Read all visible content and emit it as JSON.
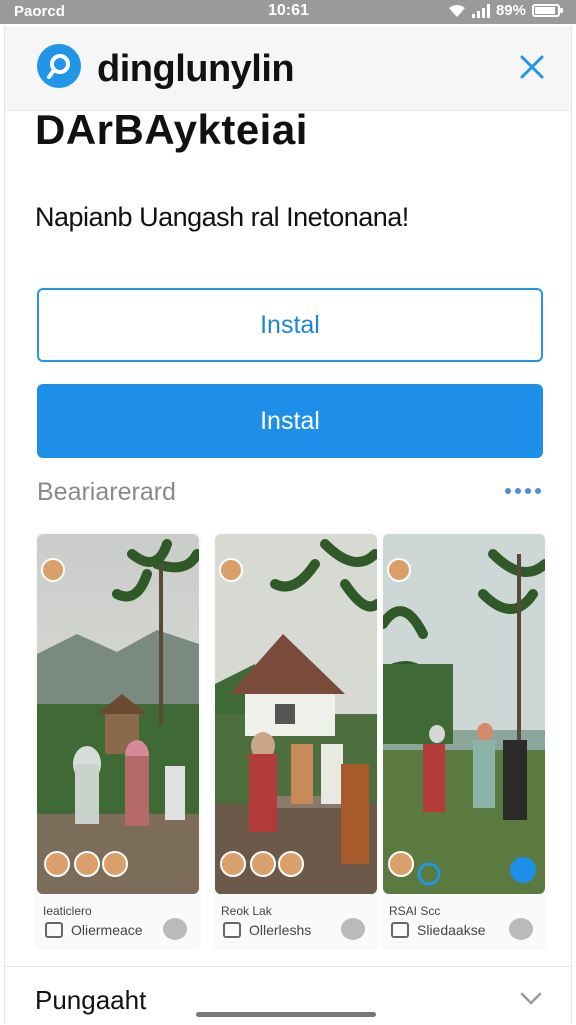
{
  "status_bar": {
    "carrier": "Paorcd",
    "time": "10:61",
    "battery": "89%",
    "battery_level": 0.89
  },
  "app": {
    "name": "dinglunylin",
    "title": "DArBAykteiai",
    "subtitle": "Napianb Uangash ral Inetonana!"
  },
  "buttons": {
    "install_outline": "Instal",
    "install_primary": "Instal"
  },
  "screenshots_section": {
    "label": "Beariarerard",
    "items": [
      {
        "caption_top": "Ieaticlero",
        "caption_bottom": "Oliermeace"
      },
      {
        "caption_top": "Reok Lak",
        "caption_bottom": "Ollerleshs"
      },
      {
        "caption_top": "RSAI Scc",
        "caption_bottom": "Sliedaakse"
      }
    ]
  },
  "footer": {
    "title": "Pungaaht"
  },
  "colors": {
    "accent": "#1e8fe8",
    "status_bar": "#9a9a9a"
  },
  "icons": {
    "logo": "app-logo-icon",
    "close": "close-icon",
    "more": "more-dots-icon",
    "expand": "chevron-down-icon"
  }
}
